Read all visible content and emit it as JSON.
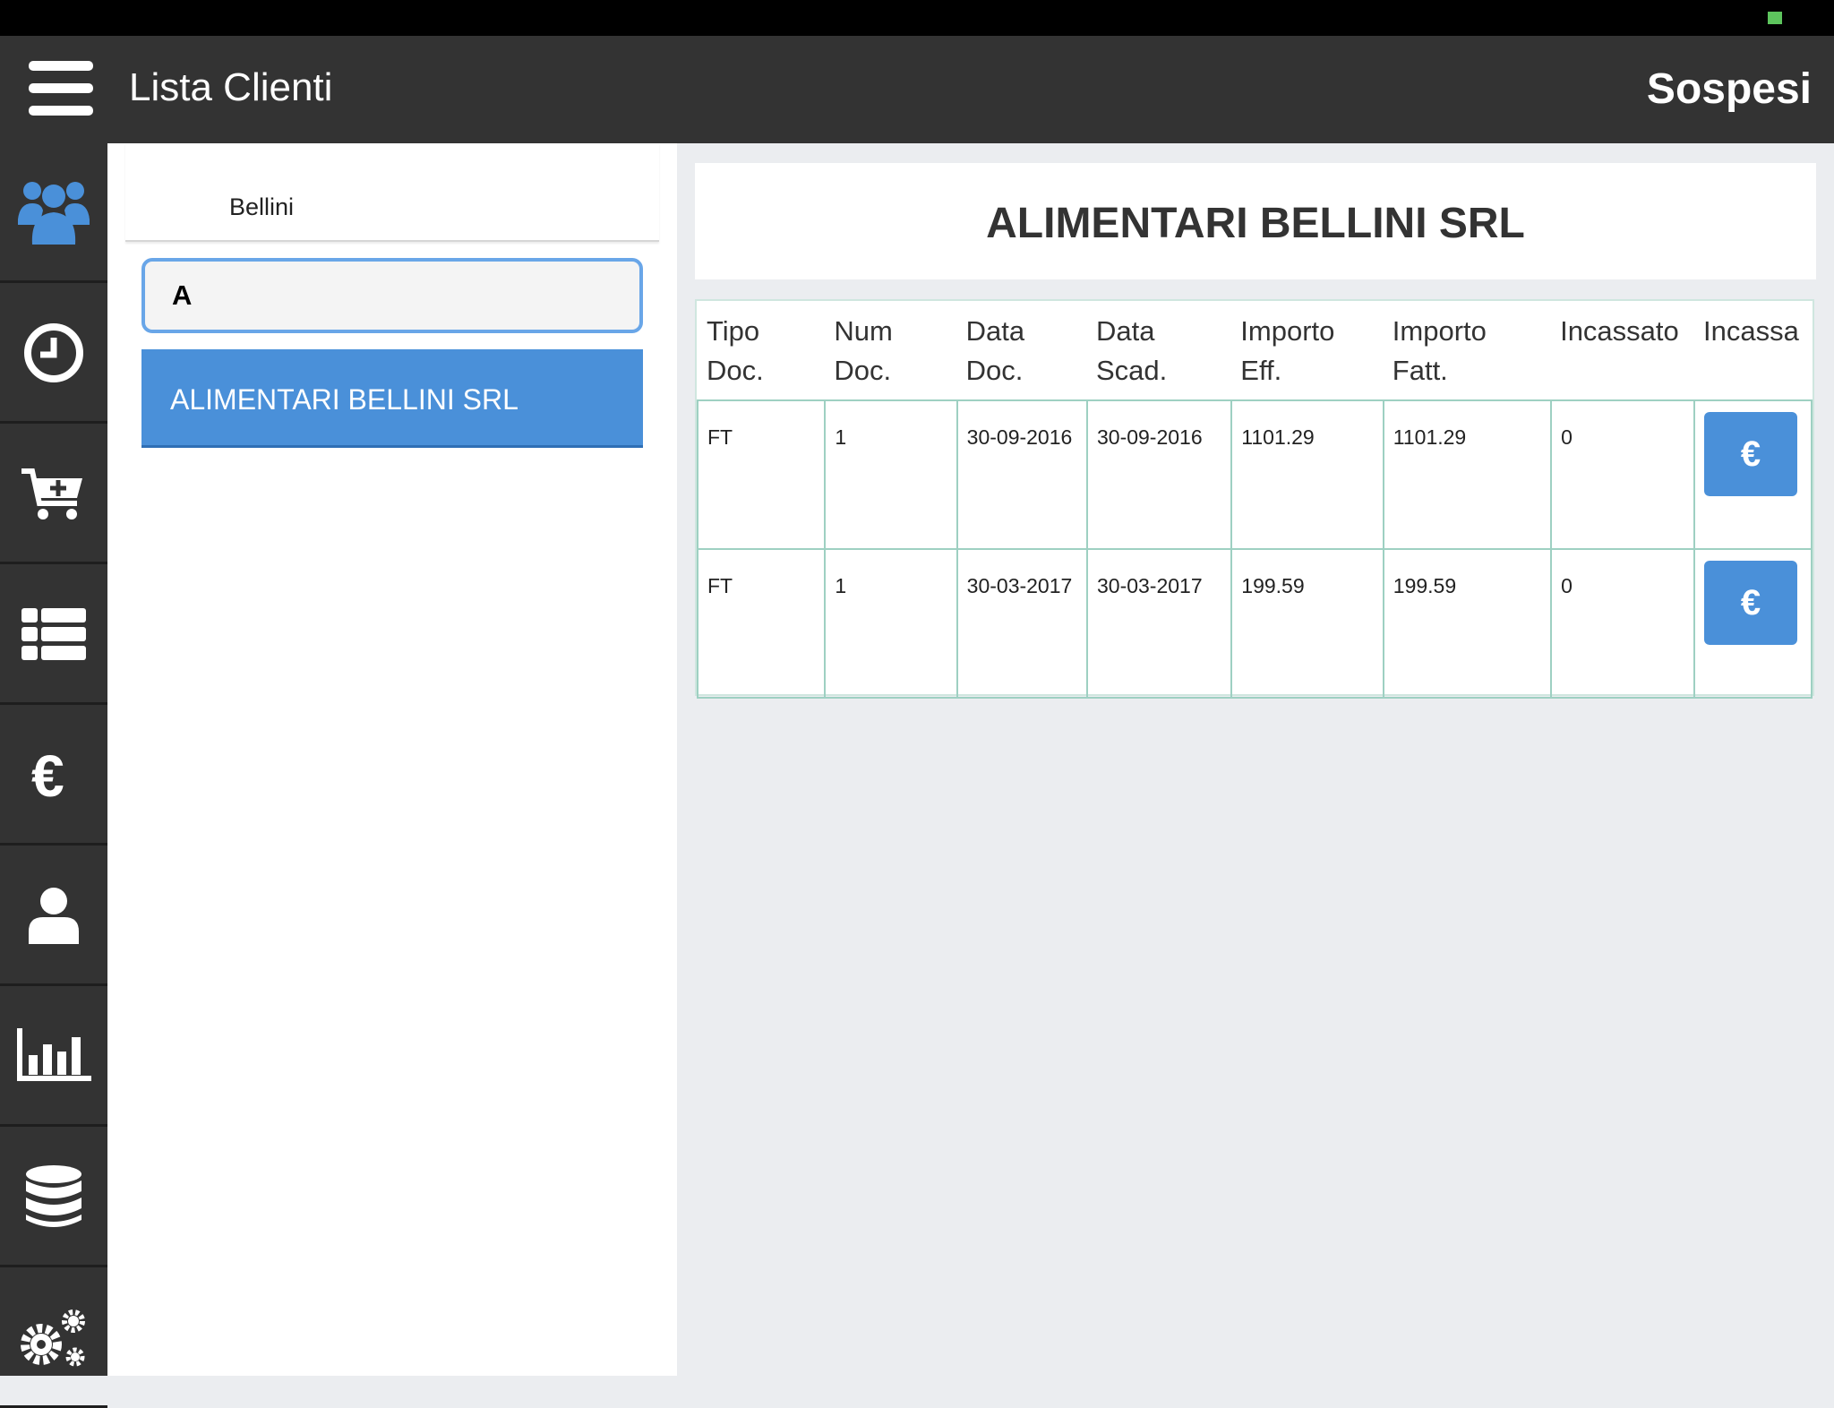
{
  "header": {
    "title": "Lista Clienti",
    "section": "Sospesi"
  },
  "sidebar": {
    "items": [
      {
        "name": "clients",
        "icon": "users-icon"
      },
      {
        "name": "history",
        "icon": "clock-icon"
      },
      {
        "name": "new-order",
        "icon": "cart-plus-icon"
      },
      {
        "name": "list",
        "icon": "list-icon"
      },
      {
        "name": "payments",
        "icon": "euro-icon"
      },
      {
        "name": "profile",
        "icon": "user-icon"
      },
      {
        "name": "statistics",
        "icon": "bar-chart-icon"
      },
      {
        "name": "database",
        "icon": "database-icon"
      },
      {
        "name": "settings",
        "icon": "gears-icon"
      }
    ]
  },
  "clients_panel": {
    "filter_label": "Bellini",
    "search_value": "A",
    "clients": [
      "ALIMENTARI BELLINI SRL"
    ]
  },
  "detail": {
    "client_name": "ALIMENTARI BELLINI SRL",
    "columns": [
      "Tipo Doc.",
      "Num Doc.",
      "Data Doc.",
      "Data Scad.",
      "Importo Eff.",
      "Importo Fatt.",
      "Incassato",
      "Incassa"
    ],
    "rows": [
      {
        "tipo": "FT",
        "num": "1",
        "data_doc": "30-09-2016",
        "data_scad": "30-09-2016",
        "importo_eff": "1101.29",
        "importo_fatt": "1101.29",
        "incassato": "0",
        "action": "€"
      },
      {
        "tipo": "FT",
        "num": "1",
        "data_doc": "30-03-2017",
        "data_scad": "30-03-2017",
        "importo_eff": "199.59",
        "importo_fatt": "199.59",
        "incassato": "0",
        "action": "€"
      }
    ]
  },
  "colors": {
    "topbar": "#333333",
    "accent": "#4a90d9",
    "table_border": "#9ed0c2"
  }
}
